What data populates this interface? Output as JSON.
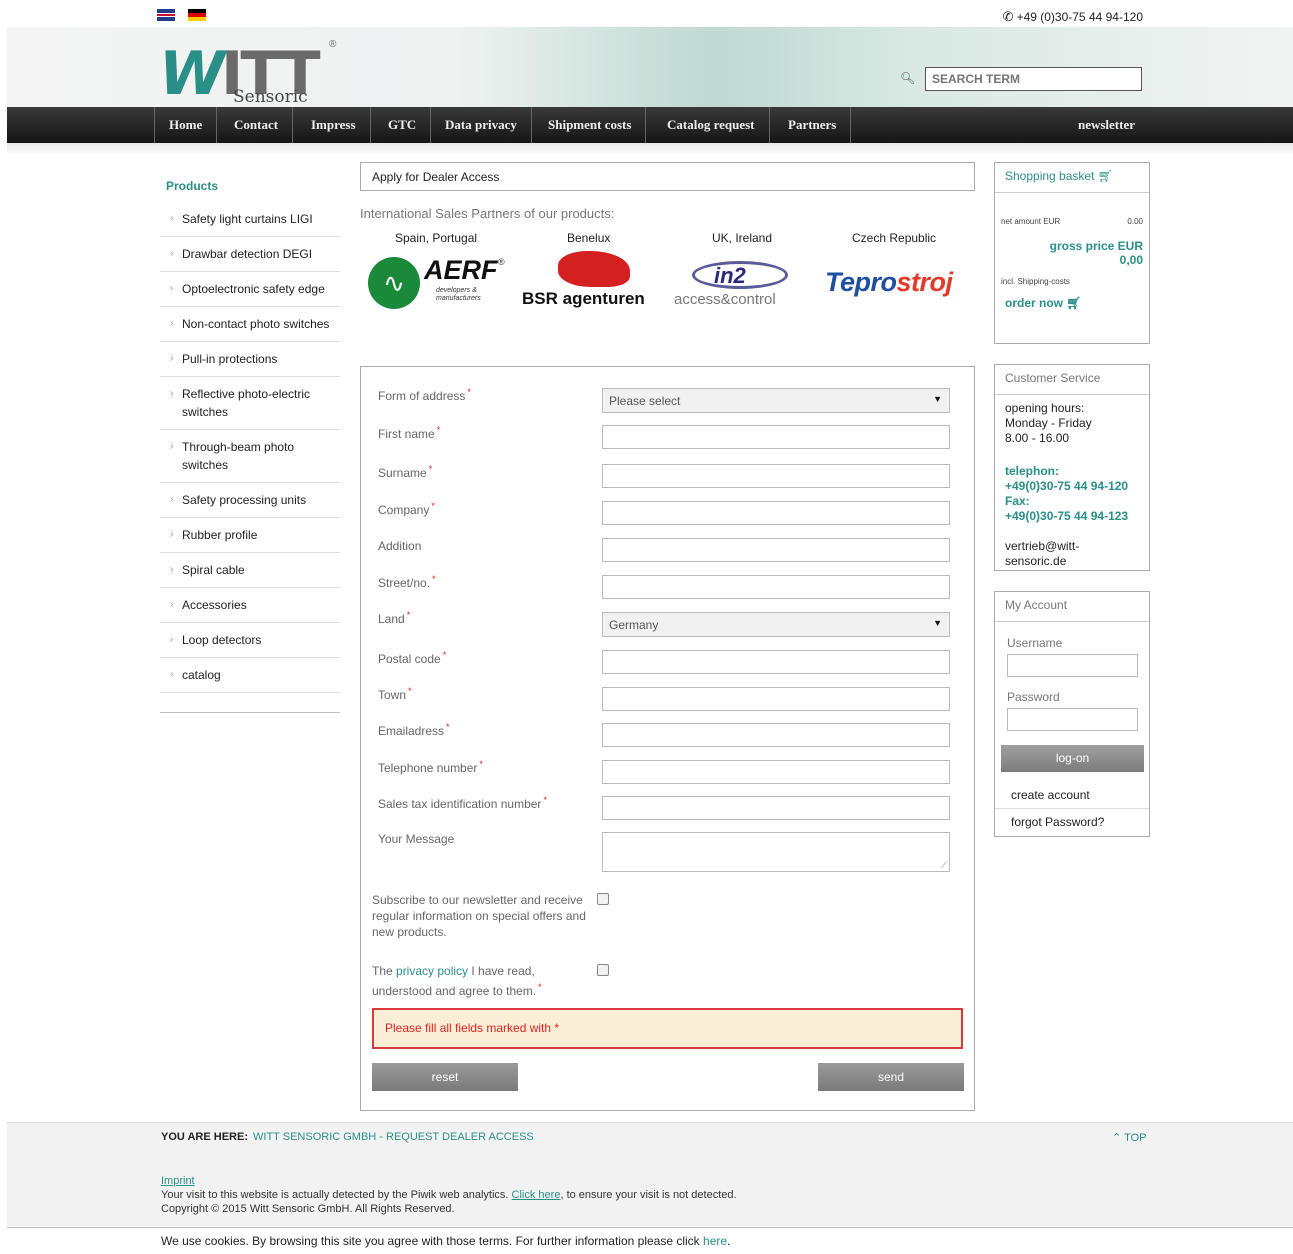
{
  "top": {
    "phone": "+49 (0)30-75 44 94-120"
  },
  "logo": {
    "main": "WITT",
    "registered": "®",
    "sub": "Sensoric"
  },
  "search": {
    "placeholder": "SEARCH TERM"
  },
  "nav": {
    "items": [
      "Home",
      "Contact",
      "Impress",
      "GTC",
      "Data privacy",
      "Shipment costs",
      "Catalog request",
      "Partners"
    ],
    "newsletter": "newsletter"
  },
  "sidebar": {
    "title": "Products",
    "items": [
      "Safety light curtains LIGI",
      "Drawbar detection DEGI",
      "Optoelectronic safety edge",
      "Non-contact photo switches",
      "Pull-in protections",
      "Reflective photo-electric switches",
      "Through-beam photo switches",
      "Safety processing units",
      "Rubber profile",
      "Spiral cable",
      "Accessories",
      "Loop detectors",
      "catalog"
    ]
  },
  "main": {
    "title": "Apply for Dealer Access",
    "partners_heading": "International Sales Partners of our products:",
    "partner_regions": [
      "Spain, Portugal",
      "Benelux",
      "UK, Ireland",
      "Czech Republic"
    ],
    "logos": {
      "aerf": "AERF",
      "aerf_registered": "®",
      "aerf_sub": "developers & manufacturers",
      "bsr": "BSR agenturen",
      "in2": "in2",
      "in2_sub": "access&control",
      "tepro_a": "Tepro",
      "tepro_b": "stroj"
    }
  },
  "form": {
    "labels": {
      "address": "Form of address",
      "first_name": "First name",
      "surname": "Surname",
      "company": "Company",
      "addition": "Addition",
      "street": "Street/no.",
      "land": "Land",
      "postal": "Postal code",
      "town": "Town",
      "email": "Emailadress",
      "phone": "Telephone number",
      "vat": "Sales tax identification number",
      "message": "Your Message"
    },
    "address_value": "Please select",
    "land_value": "Germany",
    "newsletter_text": "Subscribe to our newsletter and receive regular information on special offers and new products.",
    "privacy_pre": "The ",
    "privacy_link": "privacy policy",
    "privacy_post": " I have read, understood and agree to them.",
    "error": "Please fill all fields marked with *",
    "reset": "reset",
    "send": "send"
  },
  "basket": {
    "title": "Shopping basket",
    "net_label": "net amount EUR",
    "net_value": "0.00",
    "gross_label": "gross price EUR",
    "gross_value": "0,00",
    "shipping": "incl. Shipping-costs",
    "order": "order now"
  },
  "service": {
    "title": "Customer Service",
    "hours_1": "opening hours:",
    "hours_2": "Monday - Friday",
    "hours_3": "8.00 - 16.00",
    "tel_label": "telephon:",
    "tel": "+49(0)30-75 44 94-120",
    "fax_label": "Fax:",
    "fax": "+49(0)30-75 44 94-123",
    "email": "vertrieb@witt-sensoric.de"
  },
  "account": {
    "title": "My Account",
    "username": "Username",
    "password": "Password",
    "logon": "log-on",
    "create": "create account",
    "forgot": "forgot Password?"
  },
  "breadcrumb": {
    "label": "YOU ARE HERE:",
    "value": "WITT SENSORIC GMBH - REQUEST DEALER ACCESS",
    "top": "TOP"
  },
  "footer": {
    "imprint": "Imprint",
    "piwik_pre": "Your visit to this website is actually detected by the Piwik web analytics. ",
    "piwik_link": "Click here",
    "piwik_post": ", to ensure your visit is not detected.",
    "copyright": "Copyright © 2015 Witt Sensoric GmbH. All Rights Reserved."
  },
  "cookie": {
    "text": "We use cookies. By browsing this site you agree with those terms. For further information please click ",
    "link": "here",
    "end": "."
  }
}
